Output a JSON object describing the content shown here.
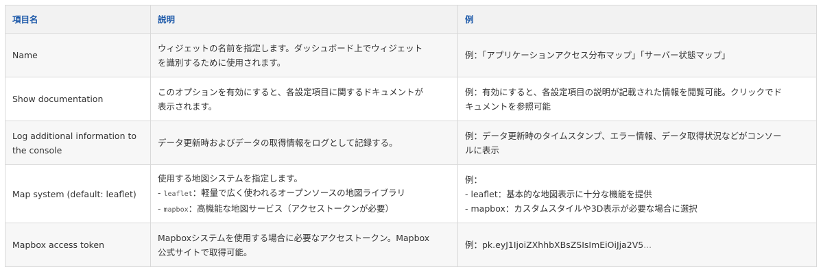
{
  "headers": {
    "col1": "項目名",
    "col2": "説明",
    "col3": "例"
  },
  "rows": [
    {
      "name": "Name",
      "desc": [
        "ウィジェットの名前を指定します。ダッシュボード上でウィジェット",
        "を識別するために使用されます。"
      ],
      "example": [
        "例：「アプリケーションアクセス分布マップ」「サーバー状態マップ」"
      ]
    },
    {
      "name": "Show documentation",
      "desc": [
        "このオプションを有効にすると、各設定項目に関するドキュメントが",
        "表示されます。"
      ],
      "example": [
        "例：有効にすると、各設定項目の説明が記載された情報を閲覧可能。クリックでド",
        "キュメントを参照可能"
      ]
    },
    {
      "name": [
        "Log additional information to",
        "the console"
      ],
      "desc": [
        "データ更新時およびデータの取得情報をログとして記録する。"
      ],
      "example": [
        "例：データ更新時のタイムスタンプ、エラー情報、データ取得状況などがコンソー",
        "ルに表示"
      ]
    },
    {
      "name": "Map system (default: leaflet)",
      "desc_intro": "使用する地図システムを指定します。",
      "desc_items": [
        {
          "dash": "-",
          "code": "leaflet",
          "text": "：軽量で広く使われるオープンソースの地図ライブラリ"
        },
        {
          "dash": "-",
          "code": "mapbox",
          "text": "：高機能な地図サービス（アクセストークンが必要）"
        }
      ],
      "example": [
        "例：",
        "- leaflet：基本的な地図表示に十分な機能を提供",
        "- mapbox：カスタムスタイルや3D表示が必要な場合に選択"
      ]
    },
    {
      "name": "Mapbox access token",
      "desc": [
        "Mapboxシステムを使用する場合に必要なアクセストークン。Mapbox",
        "公式サイトで取得可能。"
      ],
      "example_prefix": "例：pk.eyJ1IjoiZXhhbXBsZSIsImEiOiJja2V5",
      "example_suffix": "..."
    }
  ]
}
